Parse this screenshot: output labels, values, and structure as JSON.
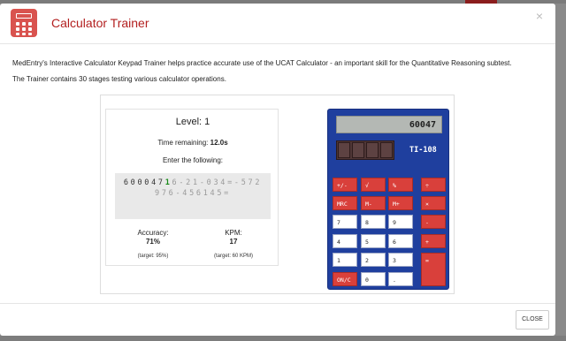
{
  "modal": {
    "title": "Calculator Trainer",
    "close_symbol": "×",
    "intro_1": "MedEntry's Interactive Calculator Keypad Trainer helps practice accurate use of the UCAT Calculator - an important skill for the Quantitative Reasoning subtest.",
    "intro_2": "The Trainer contains 30 stages testing various calculator operations.",
    "close_button": "CLOSE"
  },
  "trainer": {
    "level_label": "Level: 1",
    "time_label": "Time remaining:",
    "time_value": "12.0s",
    "enter_label": "Enter the following:",
    "sequence_done": "600047",
    "sequence_current": "1",
    "sequence_rest": "6-21-034=-572976-456145=",
    "accuracy_label": "Accuracy:",
    "accuracy_value": "71%",
    "accuracy_target": "(target: 95%)",
    "kpm_label": "KPM:",
    "kpm_value": "17",
    "kpm_target": "(target: 60 KPM)"
  },
  "calculator": {
    "display": "60047",
    "model": "TI-108",
    "keys": {
      "plus_minus": "+/-",
      "sqrt": "√",
      "percent": "%",
      "divide": "÷",
      "mrc": "MRC",
      "m_minus": "M-",
      "m_plus": "M+",
      "multiply": "×",
      "seven": "7",
      "eight": "8",
      "nine": "9",
      "minus": "-",
      "four": "4",
      "five": "5",
      "six": "6",
      "plus": "+",
      "one": "1",
      "two": "2",
      "three": "3",
      "equals": "=",
      "on_c": "ON/C",
      "zero": "0",
      "decimal": "."
    }
  },
  "colors": {
    "title_red": "#b32020",
    "calc_blue": "#1f3f9e",
    "key_red": "#d9403b",
    "current_green": "#1a8a1a"
  }
}
